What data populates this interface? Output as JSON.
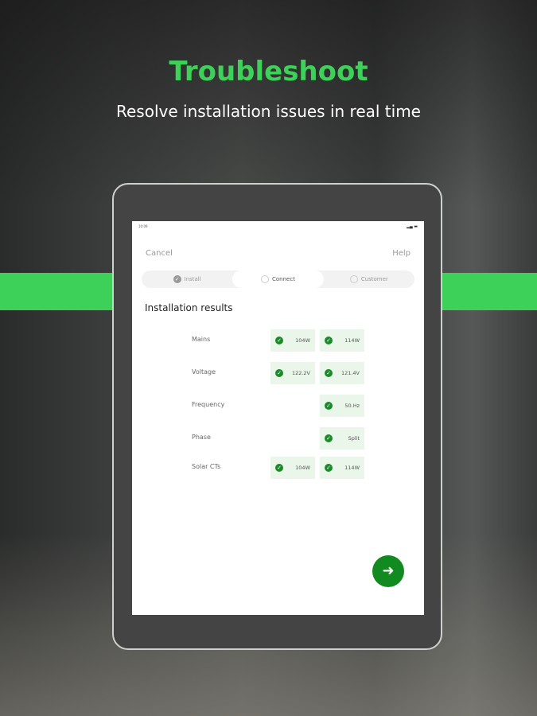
{
  "header": {
    "title": "Troubleshoot",
    "subtitle": "Resolve installation issues in real time"
  },
  "device": {
    "time": "10:09",
    "cancel": "Cancel",
    "help": "Help",
    "steps": [
      {
        "label": "Install",
        "done": true
      },
      {
        "label": "Connect"
      },
      {
        "label": "Customer"
      }
    ],
    "heading": "Installation results",
    "rows": [
      {
        "label": "Mains",
        "values": [
          "104W",
          "114W"
        ]
      },
      {
        "label": "Voltage",
        "values": [
          "122.2V",
          "121.4V"
        ]
      },
      {
        "label": "Frequency",
        "values": [
          "",
          "50.Hz"
        ]
      },
      {
        "label": "Phase",
        "values": [
          "",
          "Split"
        ]
      },
      {
        "label": "Solar CTs",
        "values": [
          "104W",
          "114W"
        ]
      }
    ],
    "next_icon": "arrow-right-icon"
  },
  "colors": {
    "accent": "#3ed15a",
    "button": "#118a1f"
  }
}
